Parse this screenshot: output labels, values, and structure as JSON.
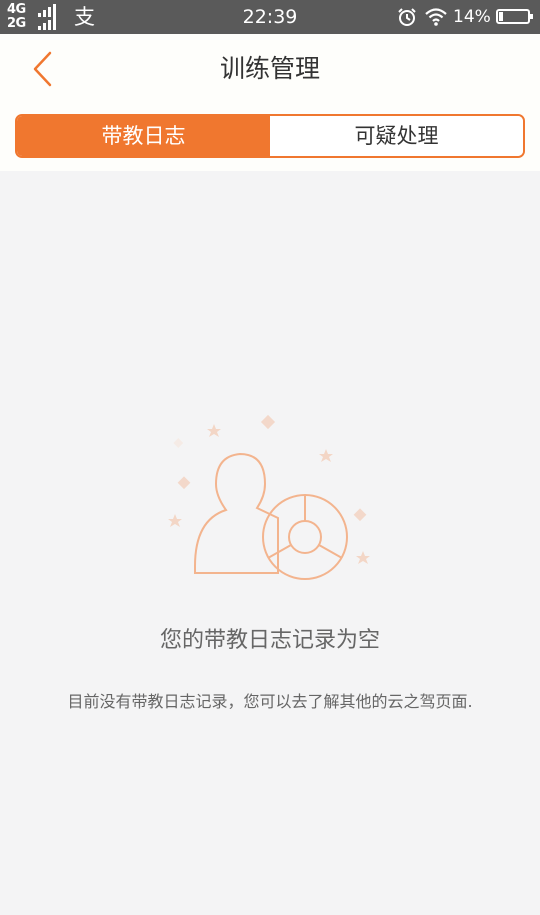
{
  "status_bar": {
    "network_top": "4G",
    "network_bottom": "2G",
    "app_glyph": "支",
    "time": "22:39",
    "battery_percent": "14%",
    "battery_level": 0.14,
    "icons": [
      "signal-icon",
      "alipay-icon",
      "alarm-icon",
      "wifi-icon",
      "battery-icon"
    ]
  },
  "header": {
    "back_icon": "chevron-left-icon",
    "title": "训练管理"
  },
  "tabs": [
    {
      "label": "带教日志",
      "active": true
    },
    {
      "label": "可疑处理",
      "active": false
    }
  ],
  "empty_state": {
    "illustration": "user-steering-wheel-icon",
    "title": "您的带教日志记录为空",
    "description": "目前没有带教日志记录，您可以去了解其他的云之驾页面."
  },
  "colors": {
    "accent": "#f0772f",
    "illustration": "#f3b48e",
    "background": "#f4f4f5",
    "status_bar": "#5a5a5a"
  }
}
